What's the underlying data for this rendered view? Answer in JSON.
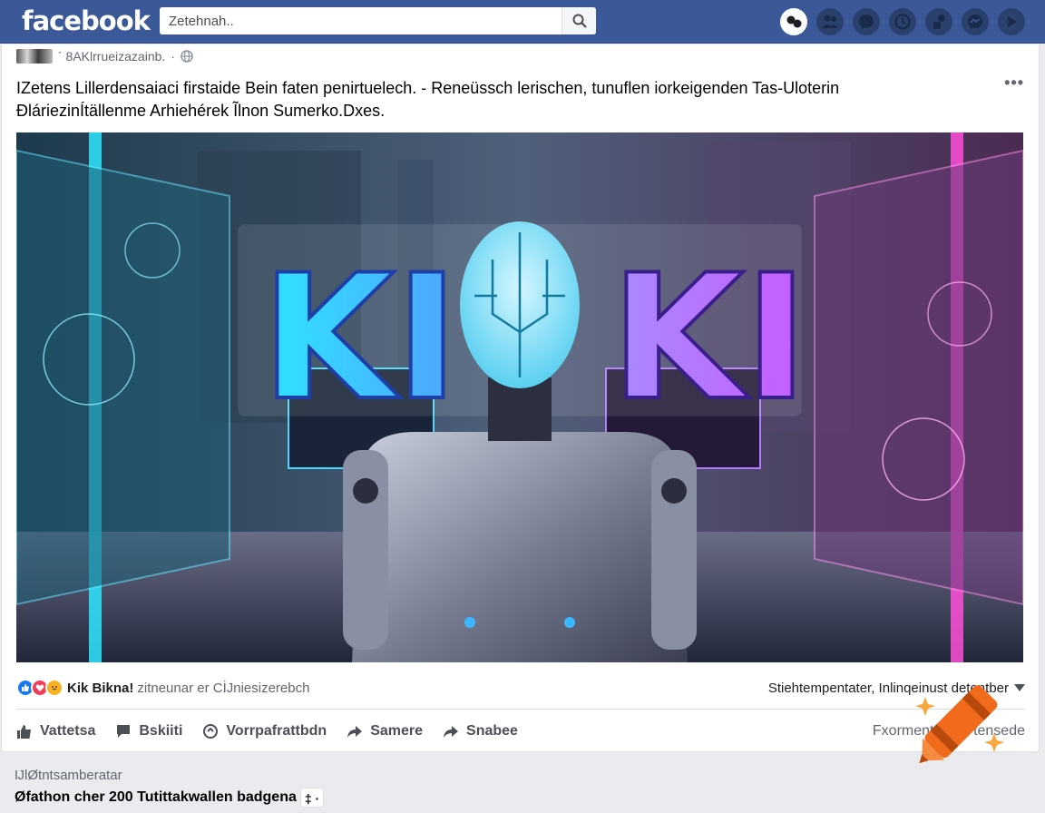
{
  "header": {
    "logo": "facebook",
    "search_placeholder": "Zetehnah..",
    "nav_icons": [
      "profile-icon",
      "friends-icon",
      "messenger-icon",
      "clock-icon",
      "group-icon",
      "messenger-icon",
      "arrow-icon"
    ]
  },
  "post": {
    "author": "´ 8AKlrrueizazainb.",
    "author_separator": "·",
    "more_label": "•••",
    "text_lines": [
      "IZetens Lillerdensaiaci firstaide Bein faten penirtuelech. - Reneüssch lerischen, tunuflen iorkeigenden Tas-Uloterin",
      "ĐláriezinÍtällenme Arhiehérek Ĩlnon Sumerko.Dxes."
    ],
    "image": {
      "banner_left": "KI",
      "banner_right": "KI",
      "description_icon": "robot-ki-image"
    },
    "reactions": {
      "names": "Kik Bikna!",
      "rest": "zitneunar er CİJniesizerebch",
      "right_text": "Stiehtempentater, Inlinqeinust detentber"
    },
    "actions": [
      {
        "icon": "like-icon",
        "label": "Vattetsa"
      },
      {
        "icon": "comment-icon",
        "label": "Bskiiti"
      },
      {
        "icon": "share-icon",
        "label": "Vorrpafrattbdn"
      },
      {
        "icon": "forward-icon",
        "label": "Samere"
      },
      {
        "icon": "forward-icon",
        "label": "Snabee"
      }
    ],
    "actions_right": "Fxormente ntal tensede"
  },
  "footer": {
    "sub": "ĲlØtntsamberatar",
    "main": "Øfathon cher 200 Tutittakwallen badgena",
    "chip": "‡ ·"
  },
  "colors": {
    "brand": "#3b5998",
    "like": "#1877f2",
    "love": "#f33e58",
    "haha": "#f7b125",
    "crayon": "#f26b1d"
  }
}
